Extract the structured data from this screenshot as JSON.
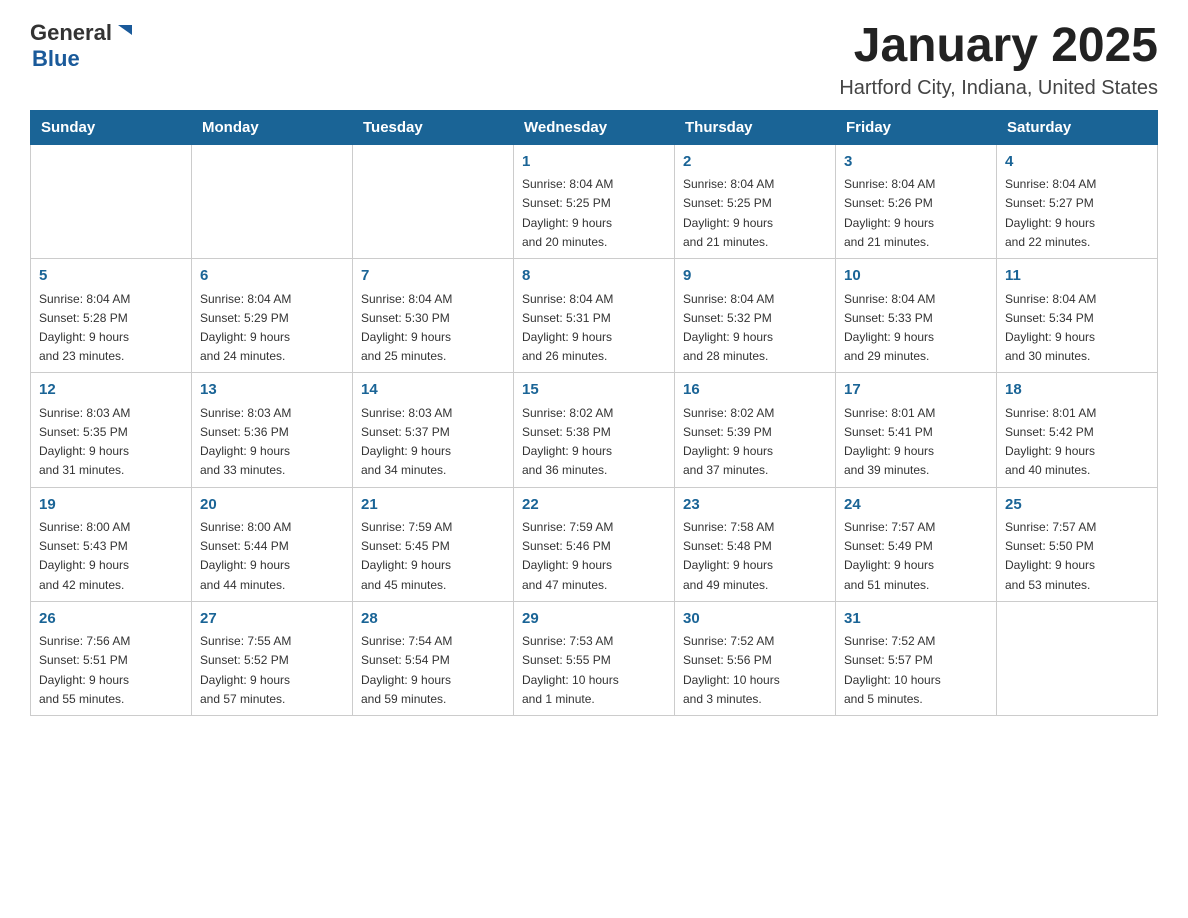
{
  "header": {
    "logo": {
      "general": "General",
      "blue": "Blue",
      "arrow": "▶"
    },
    "title": "January 2025",
    "subtitle": "Hartford City, Indiana, United States"
  },
  "weekdays": [
    "Sunday",
    "Monday",
    "Tuesday",
    "Wednesday",
    "Thursday",
    "Friday",
    "Saturday"
  ],
  "weeks": [
    [
      {
        "day": "",
        "info": ""
      },
      {
        "day": "",
        "info": ""
      },
      {
        "day": "",
        "info": ""
      },
      {
        "day": "1",
        "info": "Sunrise: 8:04 AM\nSunset: 5:25 PM\nDaylight: 9 hours\nand 20 minutes."
      },
      {
        "day": "2",
        "info": "Sunrise: 8:04 AM\nSunset: 5:25 PM\nDaylight: 9 hours\nand 21 minutes."
      },
      {
        "day": "3",
        "info": "Sunrise: 8:04 AM\nSunset: 5:26 PM\nDaylight: 9 hours\nand 21 minutes."
      },
      {
        "day": "4",
        "info": "Sunrise: 8:04 AM\nSunset: 5:27 PM\nDaylight: 9 hours\nand 22 minutes."
      }
    ],
    [
      {
        "day": "5",
        "info": "Sunrise: 8:04 AM\nSunset: 5:28 PM\nDaylight: 9 hours\nand 23 minutes."
      },
      {
        "day": "6",
        "info": "Sunrise: 8:04 AM\nSunset: 5:29 PM\nDaylight: 9 hours\nand 24 minutes."
      },
      {
        "day": "7",
        "info": "Sunrise: 8:04 AM\nSunset: 5:30 PM\nDaylight: 9 hours\nand 25 minutes."
      },
      {
        "day": "8",
        "info": "Sunrise: 8:04 AM\nSunset: 5:31 PM\nDaylight: 9 hours\nand 26 minutes."
      },
      {
        "day": "9",
        "info": "Sunrise: 8:04 AM\nSunset: 5:32 PM\nDaylight: 9 hours\nand 28 minutes."
      },
      {
        "day": "10",
        "info": "Sunrise: 8:04 AM\nSunset: 5:33 PM\nDaylight: 9 hours\nand 29 minutes."
      },
      {
        "day": "11",
        "info": "Sunrise: 8:04 AM\nSunset: 5:34 PM\nDaylight: 9 hours\nand 30 minutes."
      }
    ],
    [
      {
        "day": "12",
        "info": "Sunrise: 8:03 AM\nSunset: 5:35 PM\nDaylight: 9 hours\nand 31 minutes."
      },
      {
        "day": "13",
        "info": "Sunrise: 8:03 AM\nSunset: 5:36 PM\nDaylight: 9 hours\nand 33 minutes."
      },
      {
        "day": "14",
        "info": "Sunrise: 8:03 AM\nSunset: 5:37 PM\nDaylight: 9 hours\nand 34 minutes."
      },
      {
        "day": "15",
        "info": "Sunrise: 8:02 AM\nSunset: 5:38 PM\nDaylight: 9 hours\nand 36 minutes."
      },
      {
        "day": "16",
        "info": "Sunrise: 8:02 AM\nSunset: 5:39 PM\nDaylight: 9 hours\nand 37 minutes."
      },
      {
        "day": "17",
        "info": "Sunrise: 8:01 AM\nSunset: 5:41 PM\nDaylight: 9 hours\nand 39 minutes."
      },
      {
        "day": "18",
        "info": "Sunrise: 8:01 AM\nSunset: 5:42 PM\nDaylight: 9 hours\nand 40 minutes."
      }
    ],
    [
      {
        "day": "19",
        "info": "Sunrise: 8:00 AM\nSunset: 5:43 PM\nDaylight: 9 hours\nand 42 minutes."
      },
      {
        "day": "20",
        "info": "Sunrise: 8:00 AM\nSunset: 5:44 PM\nDaylight: 9 hours\nand 44 minutes."
      },
      {
        "day": "21",
        "info": "Sunrise: 7:59 AM\nSunset: 5:45 PM\nDaylight: 9 hours\nand 45 minutes."
      },
      {
        "day": "22",
        "info": "Sunrise: 7:59 AM\nSunset: 5:46 PM\nDaylight: 9 hours\nand 47 minutes."
      },
      {
        "day": "23",
        "info": "Sunrise: 7:58 AM\nSunset: 5:48 PM\nDaylight: 9 hours\nand 49 minutes."
      },
      {
        "day": "24",
        "info": "Sunrise: 7:57 AM\nSunset: 5:49 PM\nDaylight: 9 hours\nand 51 minutes."
      },
      {
        "day": "25",
        "info": "Sunrise: 7:57 AM\nSunset: 5:50 PM\nDaylight: 9 hours\nand 53 minutes."
      }
    ],
    [
      {
        "day": "26",
        "info": "Sunrise: 7:56 AM\nSunset: 5:51 PM\nDaylight: 9 hours\nand 55 minutes."
      },
      {
        "day": "27",
        "info": "Sunrise: 7:55 AM\nSunset: 5:52 PM\nDaylight: 9 hours\nand 57 minutes."
      },
      {
        "day": "28",
        "info": "Sunrise: 7:54 AM\nSunset: 5:54 PM\nDaylight: 9 hours\nand 59 minutes."
      },
      {
        "day": "29",
        "info": "Sunrise: 7:53 AM\nSunset: 5:55 PM\nDaylight: 10 hours\nand 1 minute."
      },
      {
        "day": "30",
        "info": "Sunrise: 7:52 AM\nSunset: 5:56 PM\nDaylight: 10 hours\nand 3 minutes."
      },
      {
        "day": "31",
        "info": "Sunrise: 7:52 AM\nSunset: 5:57 PM\nDaylight: 10 hours\nand 5 minutes."
      },
      {
        "day": "",
        "info": ""
      }
    ]
  ]
}
